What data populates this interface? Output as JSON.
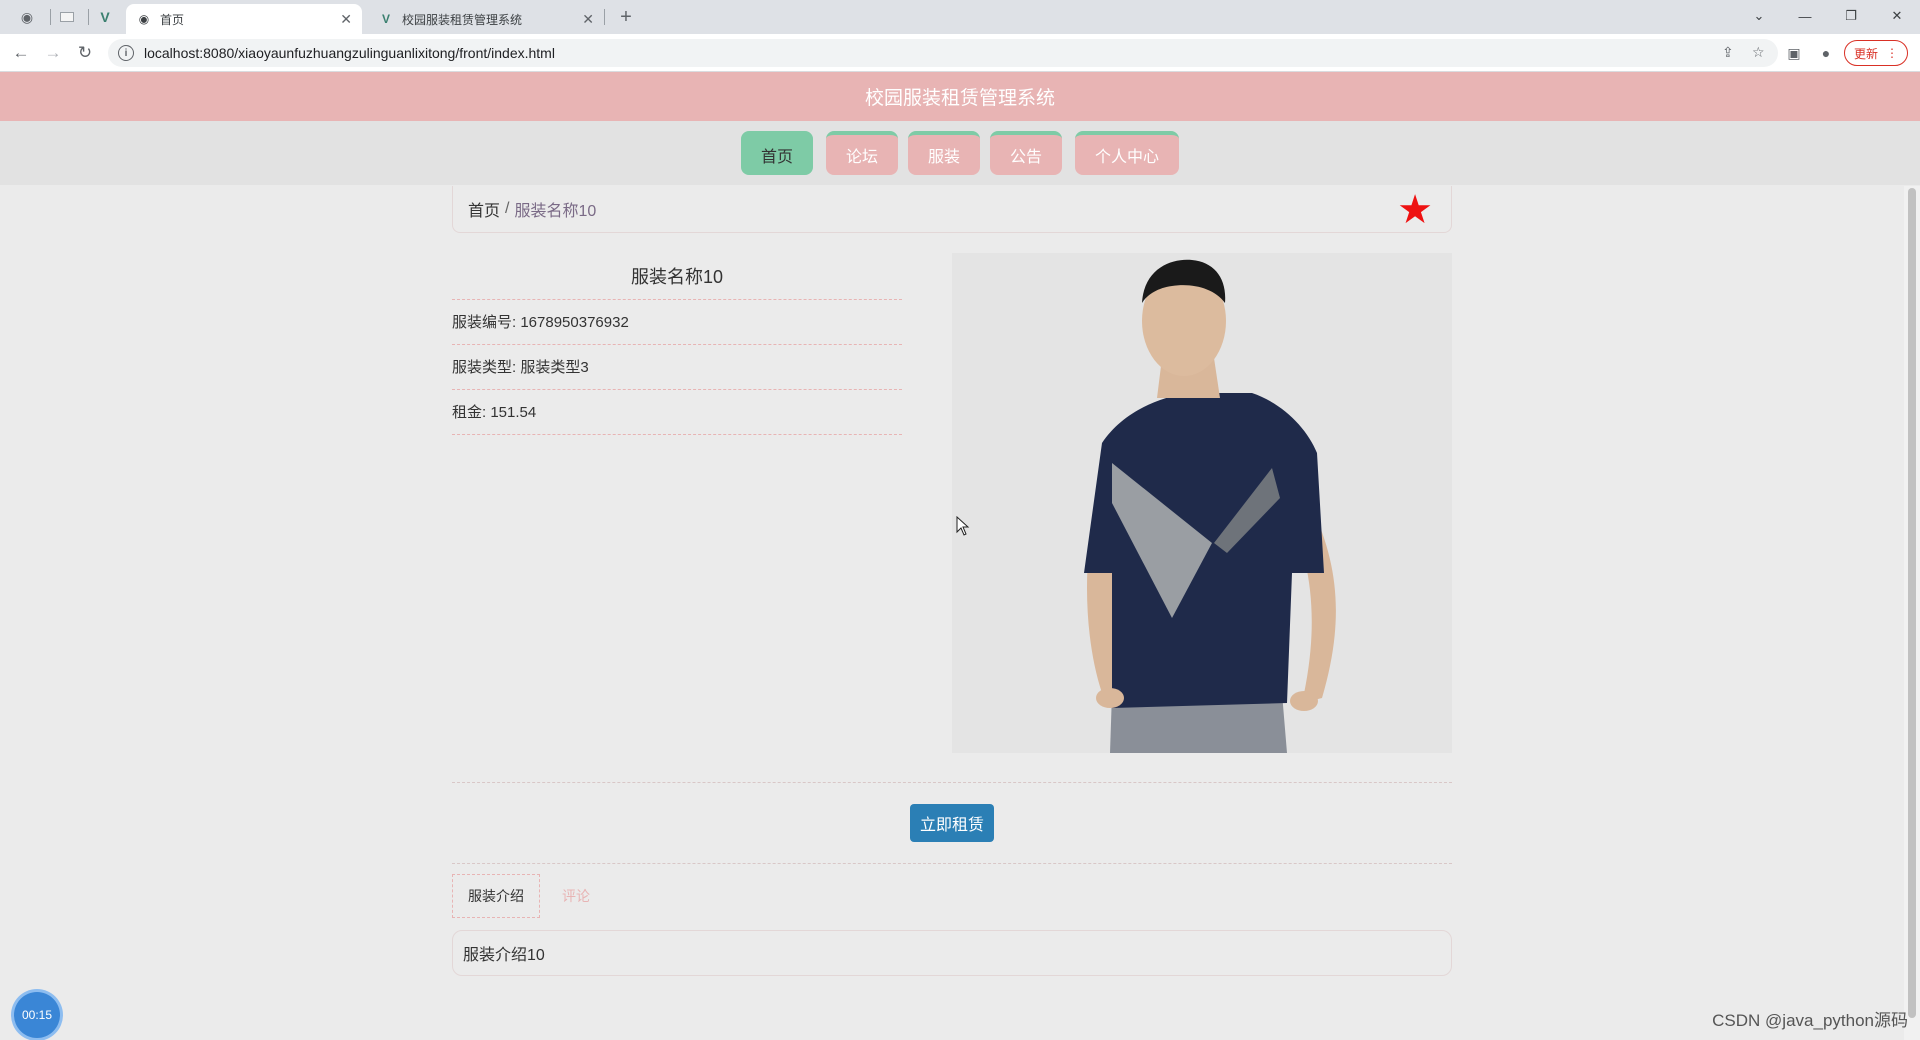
{
  "browser": {
    "tabs": [
      {
        "title": "首页",
        "active": true
      },
      {
        "title": "校园服装租赁管理系统",
        "active": false
      }
    ],
    "url": "localhost:8080/xiaoyaunfuzhuangzulinguanlixitong/front/index.html",
    "update_label": "更新"
  },
  "site": {
    "title": "校园服装租赁管理系统",
    "nav": [
      "首页",
      "论坛",
      "服装",
      "公告",
      "个人中心"
    ]
  },
  "breadcrumb": {
    "home": "首页",
    "separator": "/",
    "current": "服装名称10"
  },
  "product": {
    "name": "服装名称10",
    "code_label": "服装编号: ",
    "code_value": "1678950376932",
    "type_label": "服装类型: ",
    "type_value": "服装类型3",
    "price_label": "租金: ",
    "price_value": "151.54",
    "image_icon": "product-photo"
  },
  "actions": {
    "rent_label": "立即租赁"
  },
  "detail_tabs": {
    "intro_label": "服装介绍",
    "comment_label": "评论",
    "intro_content": "服装介绍10"
  },
  "overlay": {
    "timer": "00:15",
    "watermark": "CSDN @java_python源码"
  },
  "colors": {
    "header_pink": "#e8b4b4",
    "nav_green": "#7ecba6",
    "rent_blue": "#2b7fb5",
    "star_red": "#ee1111"
  }
}
